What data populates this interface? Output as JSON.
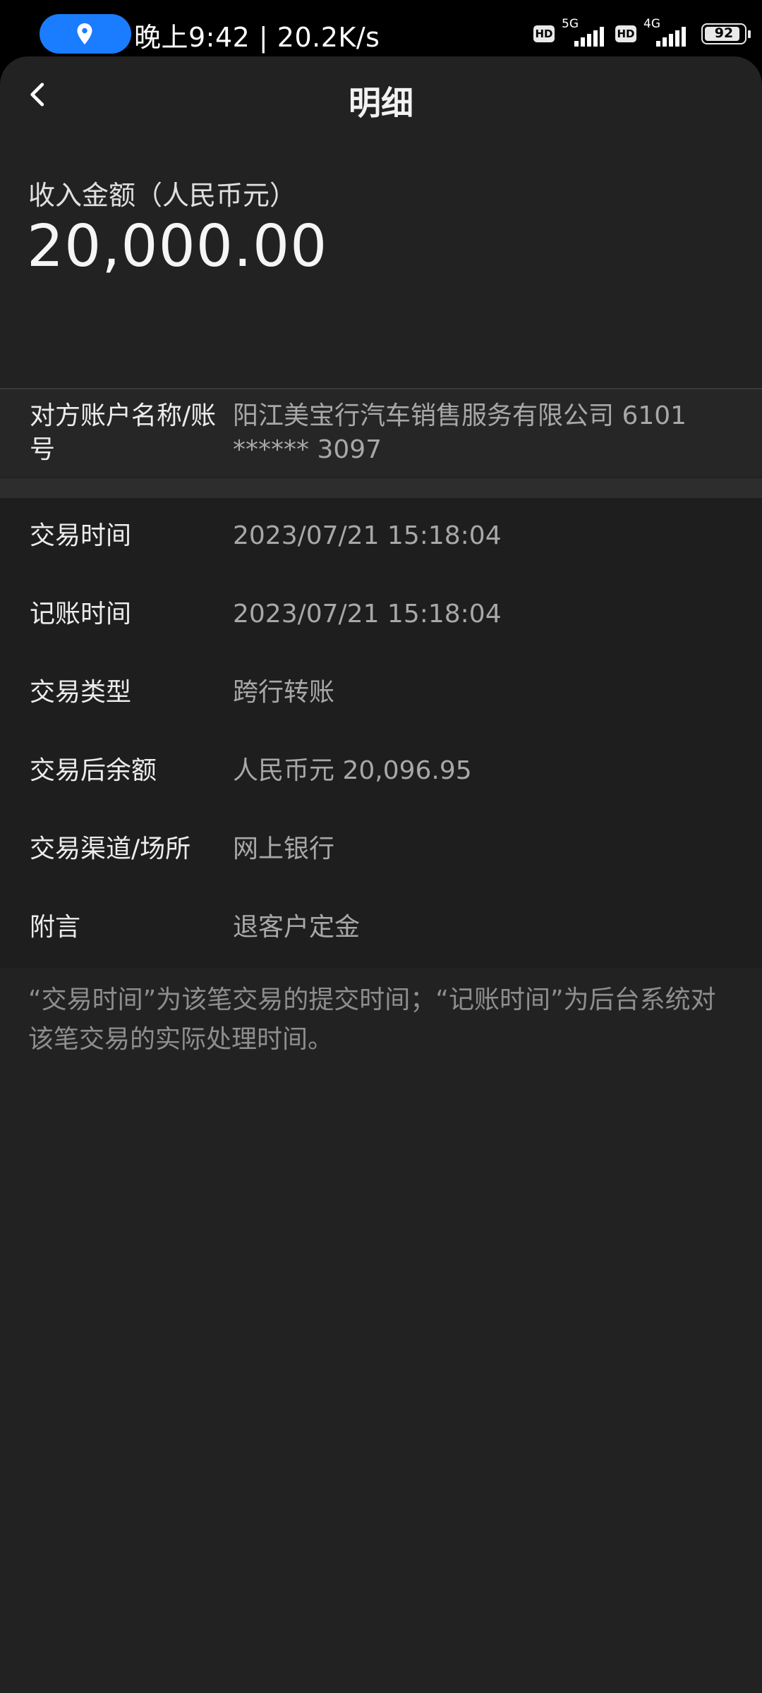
{
  "status_bar": {
    "time_speed": "晚上9:42 | 20.2K/s",
    "location_icon": "location-pin-icon",
    "hd_badge": "HD",
    "network1": "5G",
    "network2": "4G",
    "battery": "92"
  },
  "header": {
    "title": "明细",
    "back_icon": "chevron-left-icon"
  },
  "amount": {
    "label": "收入金额（人民币元）",
    "value": "20,000.00"
  },
  "account": {
    "label": "对方账户名称/账号",
    "value": "阳江美宝行汽车销售服务有限公司 6101 ****** 3097"
  },
  "details": [
    {
      "label": "交易时间",
      "value": "2023/07/21  15:18:04"
    },
    {
      "label": "记账时间",
      "value": "2023/07/21  15:18:04"
    },
    {
      "label": "交易类型",
      "value": "跨行转账"
    },
    {
      "label": "交易后余额",
      "value": "人民币元 20,096.95"
    },
    {
      "label": "交易渠道/场所",
      "value": "网上银行"
    },
    {
      "label": "附言",
      "value": "退客户定金"
    }
  ],
  "note": "“交易时间”为该笔交易的提交时间；“记账时间”为后台系统对该笔交易的实际处理时间。"
}
